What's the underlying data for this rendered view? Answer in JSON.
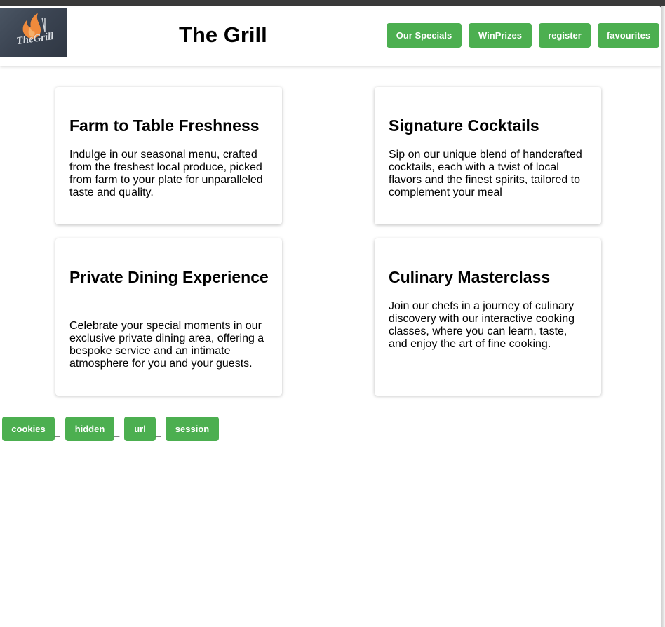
{
  "header": {
    "logo_text": "TheGrill",
    "title": "The Grill",
    "nav": [
      {
        "label": "Our Specials"
      },
      {
        "label": "WinPrizes"
      },
      {
        "label": "register"
      },
      {
        "label": "favourites"
      }
    ]
  },
  "cards": [
    {
      "title": "Farm to Table Freshness",
      "text": "Indulge in our seasonal menu, crafted from the freshest local produce, picked from farm to your plate for unparalleled taste and quality."
    },
    {
      "title": "Signature Cocktails",
      "text": "Sip on our unique blend of handcrafted cocktails, each with a twist of local flavors and the finest spirits, tailored to complement your meal"
    },
    {
      "title": "Private Dining Experience",
      "text": "Celebrate your special moments in our exclusive private dining area, offering a bespoke service and an intimate atmosphere for you and your guests."
    },
    {
      "title": "Culinary Masterclass",
      "text": "Join our chefs in a journey of culinary discovery with our interactive cooking classes, where you can learn, taste, and enjoy the art of fine cooking."
    }
  ],
  "footer_links": [
    {
      "label": "cookies"
    },
    {
      "label": "hidden"
    },
    {
      "label": "url"
    },
    {
      "label": "session"
    }
  ],
  "separator": "_",
  "colors": {
    "accent": "#4caf50",
    "logo_bg": "#3b4452",
    "flame": "#f08a3c"
  }
}
